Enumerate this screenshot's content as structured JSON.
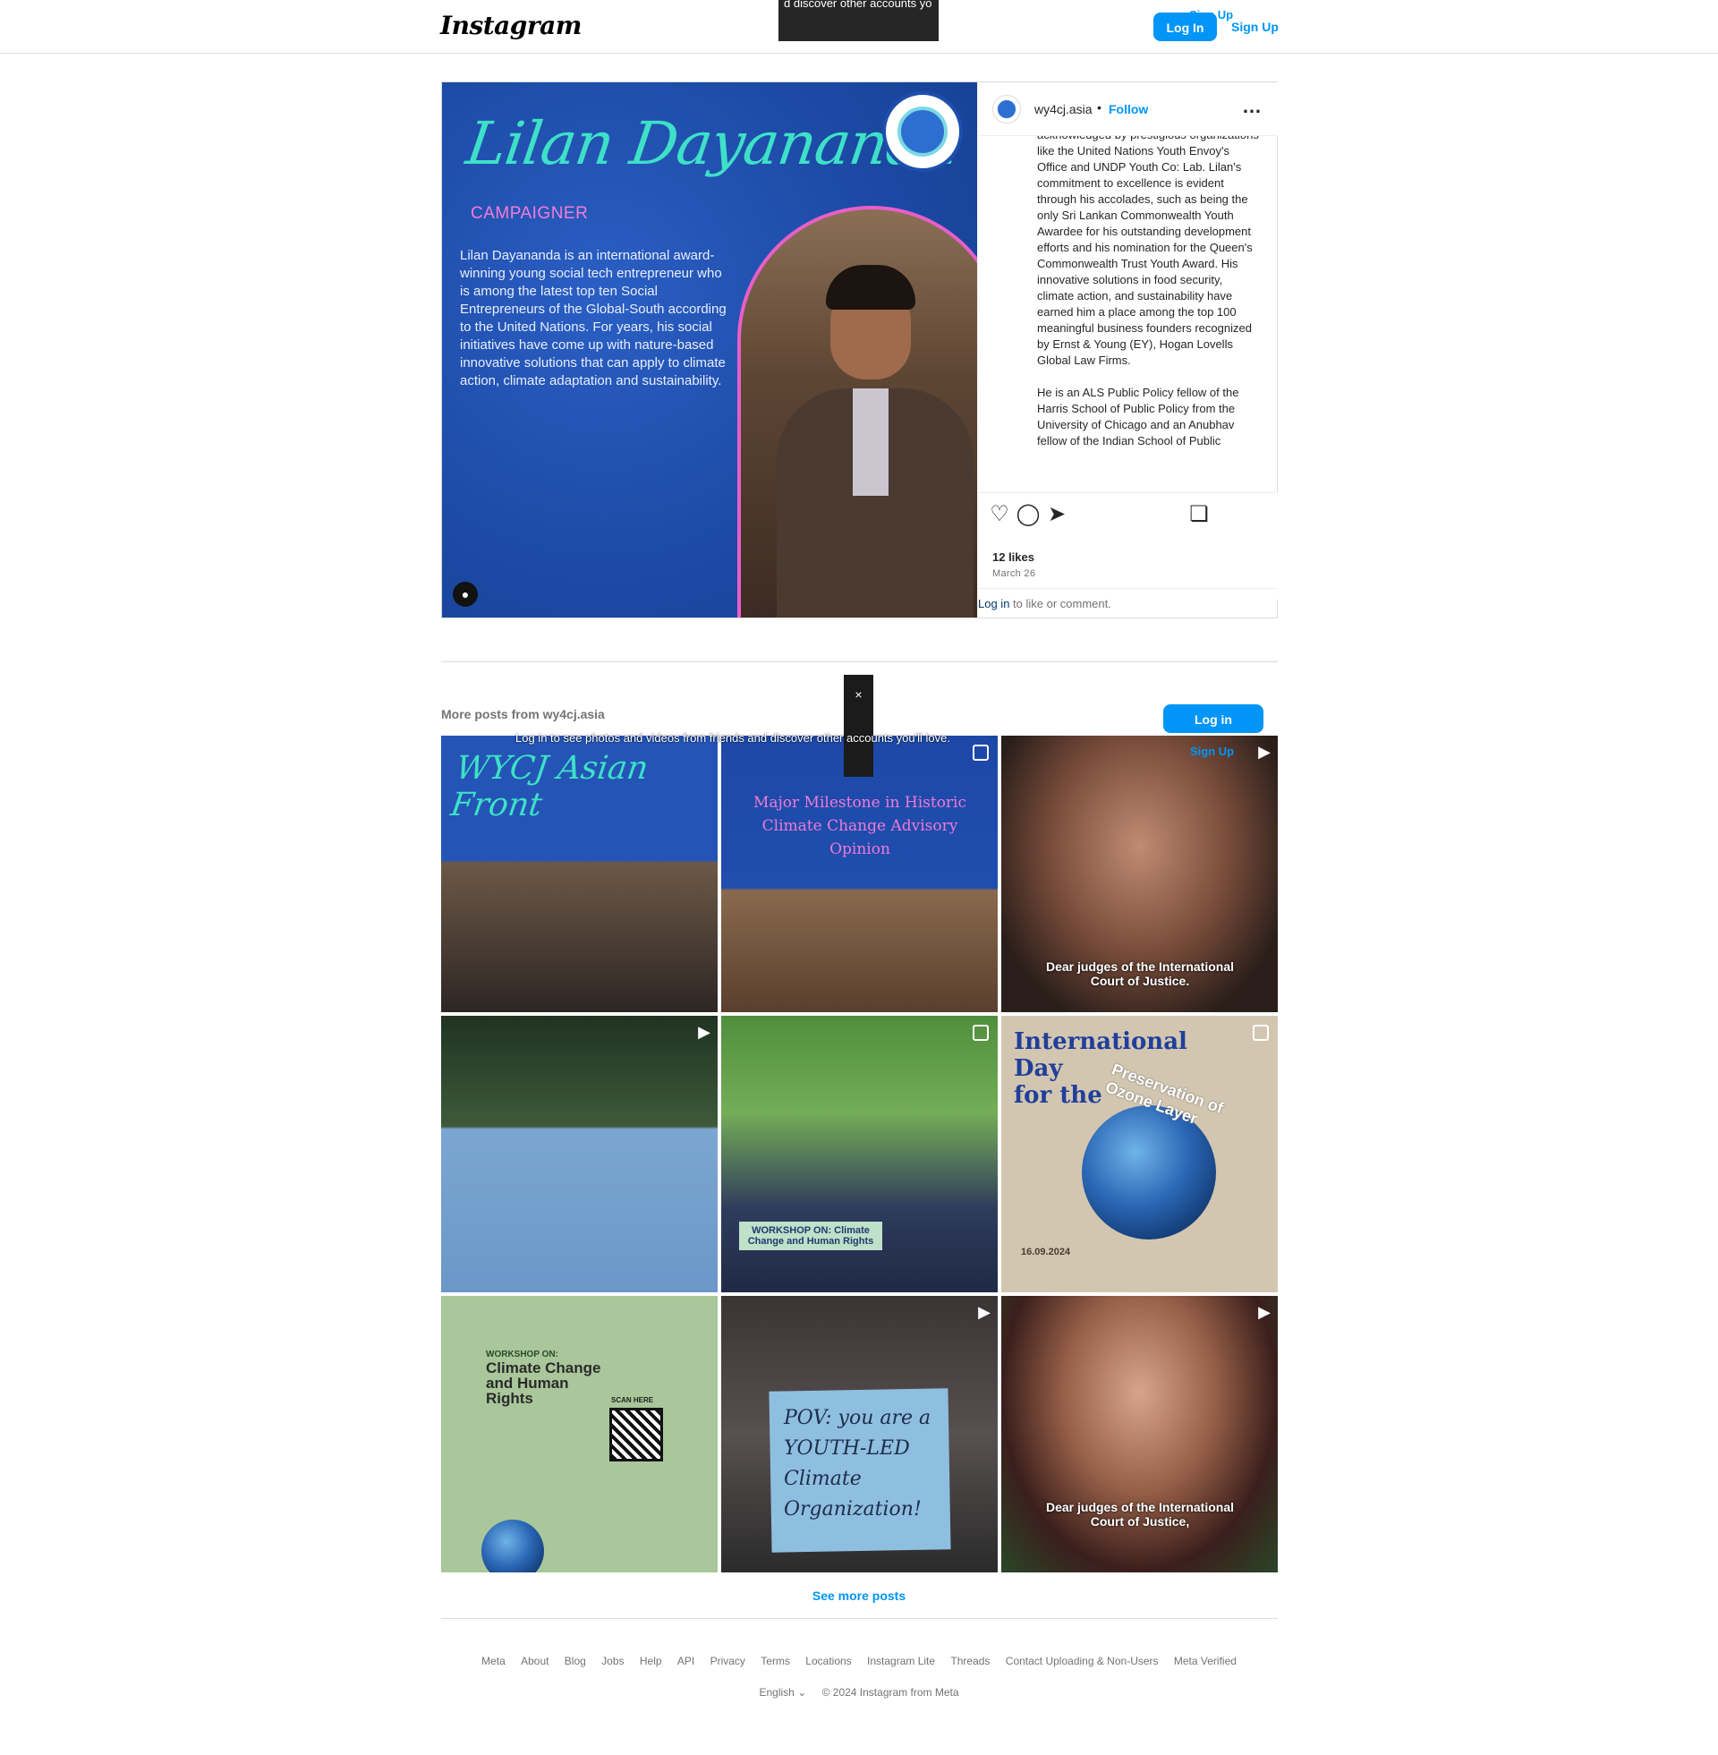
{
  "header": {
    "logo": "Instagram",
    "overlay_text": "d discover other accounts yo",
    "login_label": "Log In",
    "signup_label": "Sign Up",
    "signup_ghost": "Sign Up"
  },
  "post": {
    "image": {
      "name_script": "Lilan Dayananda",
      "role": "CAMPAIGNER",
      "bio": "Lilan Dayananda is an international award-winning young social tech entrepreneur who is among the latest top ten Social Entrepreneurs of the Global-South according to the United Nations. For years, his social initiatives have come up with nature-based innovative solutions that can apply to climate action, climate adaptation and sustainability."
    },
    "username": "wy4cj.asia",
    "dot": "•",
    "follow_label": "Follow",
    "more_icon": "more-horizontal-icon",
    "caption_p1": "acknowledged by prestigious organizations like the United Nations Youth Envoy's Office and UNDP Youth Co: Lab. Lilan's commitment to excellence is evident through his accolades, such as being the only Sri Lankan Commonwealth Youth Awardee for his outstanding development efforts and his nomination for the Queen's Commonwealth Trust Youth Award. His innovative solutions in food security, climate action, and sustainability have earned him a place among the top 100 meaningful business founders recognized by Ernst & Young (EY), Hogan Lovells Global Law Firms.",
    "caption_p2": "He is an ALS Public Policy fellow of the Harris School of Public Policy from the University of Chicago and an Anubhav fellow of the Indian School of Public",
    "likes": "12 likes",
    "date": "March 26",
    "login_link": "Log in",
    "login_suffix": " to like or comment.",
    "icons": [
      "heart-icon",
      "comment-icon",
      "share-icon",
      "bookmark-icon"
    ]
  },
  "more_posts": {
    "title": "More posts from wy4cj.asia",
    "overlay_text": "Log in to see photos and videos from friends and discover other accounts you'll love.",
    "close_icon": "×",
    "login_label": "Log in",
    "signup_label": "Sign Up",
    "tiles": [
      {
        "text": "WYCJ Asian Front"
      },
      {
        "text": "Major Milestone in Historic Climate Change Advisory Opinion"
      },
      {
        "text": "Dear judges of the International Court of Justice."
      },
      {
        "text": ""
      },
      {
        "text": "WORKSHOP ON: Climate Change and Human Rights"
      },
      {
        "text_line1": "International",
        "text_line2": "Day",
        "text_line3": "for the",
        "arc": "Preservation of Ozone Layer",
        "date": "16.09.2024"
      },
      {
        "small": "WORKSHOP ON:",
        "title": "Climate Change and Human Rights",
        "scan": "SCAN HERE"
      },
      {
        "text": "POV: you are a YOUTH-LED Climate Organization!"
      },
      {
        "text": "Dear judges of the International Court of Justice,"
      }
    ],
    "see_more": "See more posts"
  },
  "footer": {
    "links": [
      "Meta",
      "About",
      "Blog",
      "Jobs",
      "Help",
      "API",
      "Privacy",
      "Terms",
      "Locations",
      "Instagram Lite",
      "Threads",
      "Contact Uploading & Non-Users",
      "Meta Verified"
    ],
    "language": "English",
    "copyright": "© 2024 Instagram from Meta"
  }
}
